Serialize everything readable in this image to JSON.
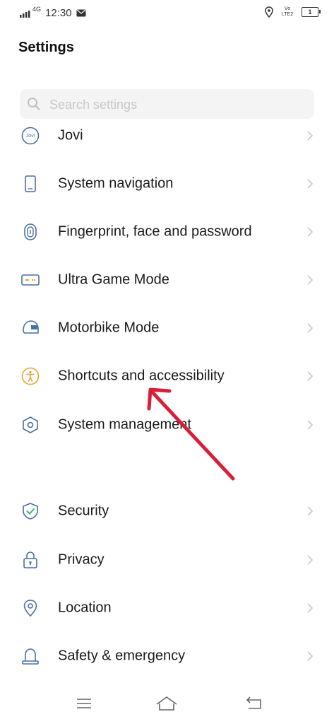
{
  "status_bar": {
    "network": "4G",
    "time": "12:30",
    "volte": "Vo LTE2",
    "battery": "1"
  },
  "header": {
    "title": "Settings"
  },
  "search": {
    "placeholder": "Search settings"
  },
  "menu": {
    "items": [
      {
        "label": "Jovi",
        "icon": "jovi-icon",
        "icon_text": "Jovi"
      },
      {
        "label": "System navigation",
        "icon": "phone-icon"
      },
      {
        "label": "Fingerprint, face and password",
        "icon": "fingerprint-icon"
      },
      {
        "label": "Ultra Game Mode",
        "icon": "gamepad-icon"
      },
      {
        "label": "Motorbike Mode",
        "icon": "helmet-icon"
      },
      {
        "label": "Shortcuts and accessibility",
        "icon": "accessibility-icon"
      },
      {
        "label": "System management",
        "icon": "hexagon-icon"
      },
      {
        "label": "Security",
        "icon": "shield-icon"
      },
      {
        "label": "Privacy",
        "icon": "lock-icon"
      },
      {
        "label": "Location",
        "icon": "location-pin-icon"
      },
      {
        "label": "Safety & emergency",
        "icon": "alarm-bell-icon"
      }
    ]
  },
  "colors": {
    "icon_blue": "#4a6fa5",
    "icon_gold": "#e0a53a",
    "icon_green": "#3cb371",
    "annotation_arrow": "#d6203a"
  }
}
